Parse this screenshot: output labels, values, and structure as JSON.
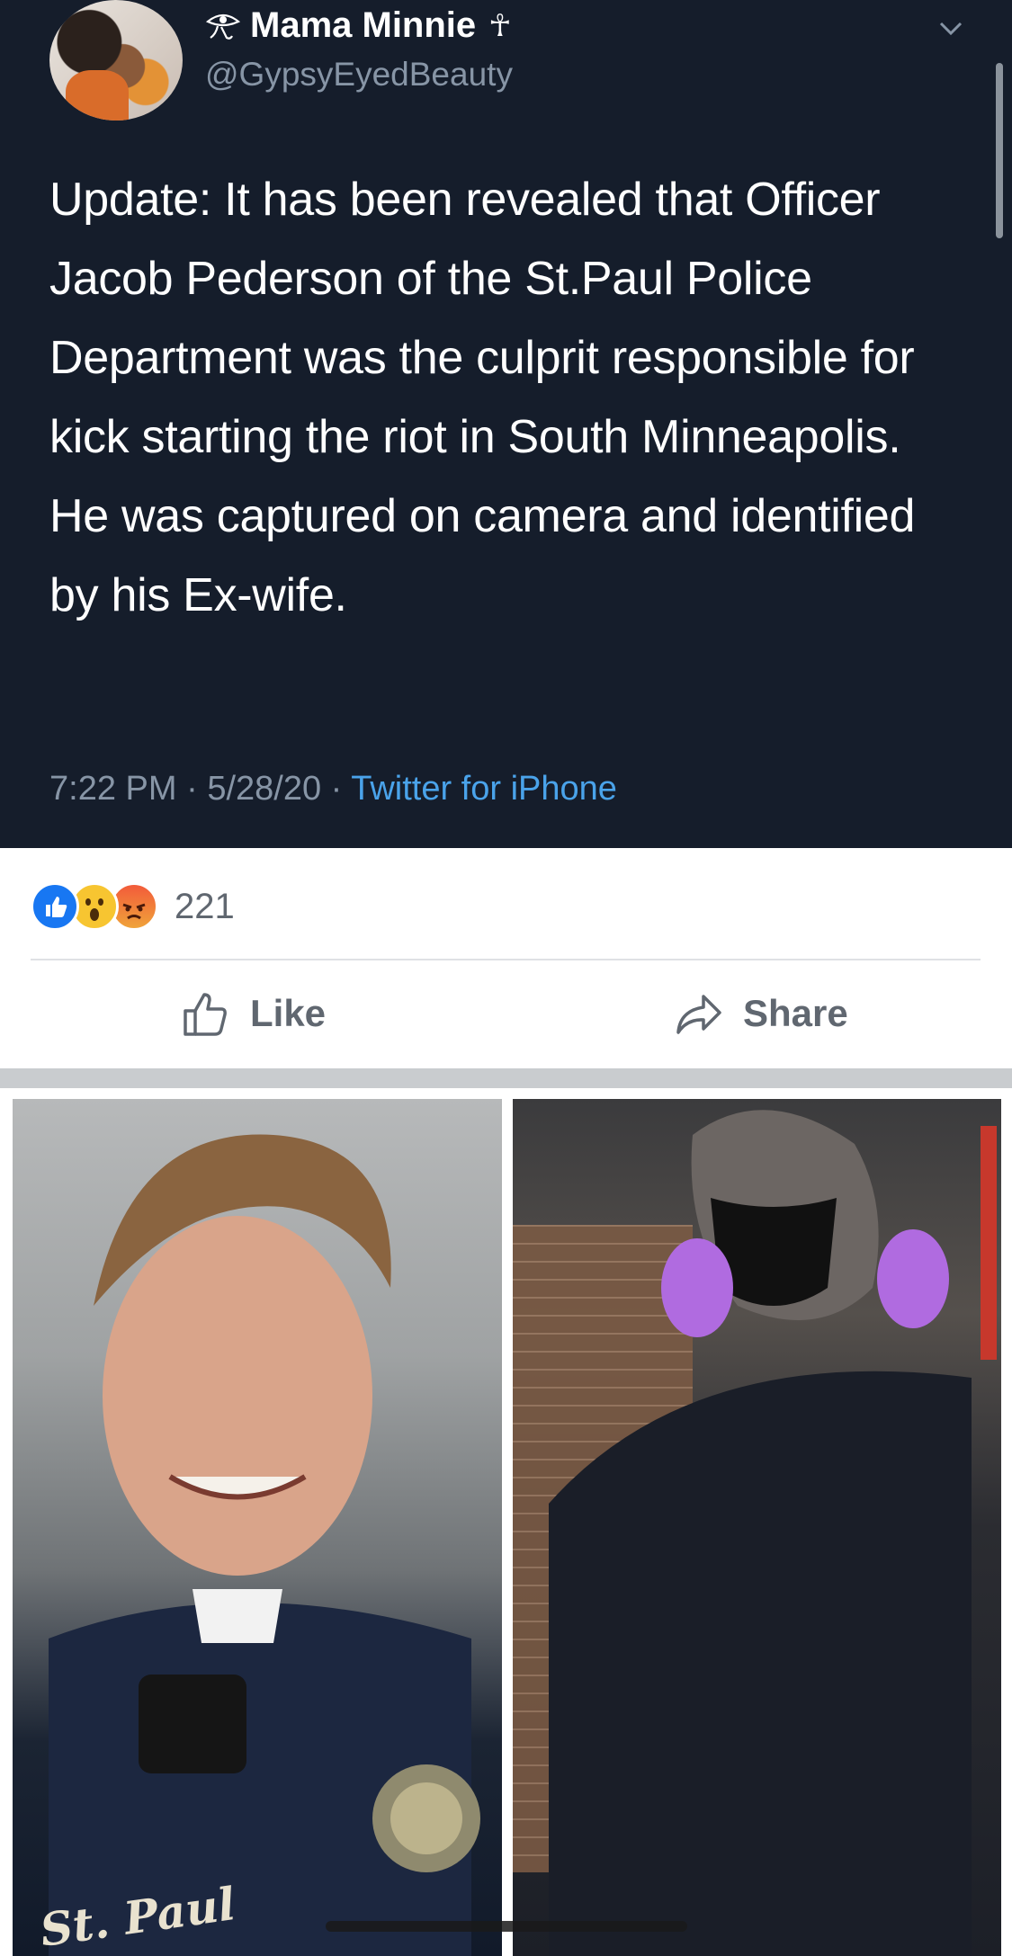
{
  "tweet": {
    "display_name": "Mama Minnie",
    "display_name_suffix": "☥",
    "handle": "@GypsyEyedBeauty",
    "text": "Update: It has been revealed that Officer Jacob Pederson of the St.Paul Police Department was the culprit responsible for kick starting the riot in South Minneapolis. He was captured on camera and identified by his Ex-wife.",
    "time": "7:22 PM",
    "date": "5/28/20",
    "separator": "·",
    "source": "Twitter for iPhone"
  },
  "reactions": {
    "count": "221",
    "types": [
      "like-icon",
      "wow-icon",
      "angry-icon"
    ]
  },
  "actions": {
    "like_label": "Like",
    "share_label": "Share"
  },
  "photo": {
    "caption_overlay": "St. Paul"
  },
  "colors": {
    "tweet_bg": "#151d2b",
    "link_blue": "#4aa3ea",
    "muted": "#8795a6",
    "fb_blue": "#1877f2"
  }
}
